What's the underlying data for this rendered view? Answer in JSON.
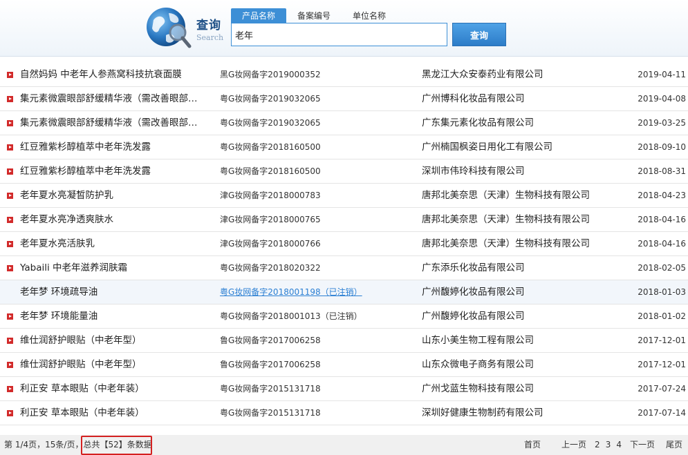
{
  "logo": {
    "cn": "查询",
    "en": "Search"
  },
  "search": {
    "tabs": [
      {
        "label": "产品名称",
        "active": true
      },
      {
        "label": "备案编号",
        "active": false
      },
      {
        "label": "单位名称",
        "active": false
      }
    ],
    "value": "老年",
    "button_label": "查询"
  },
  "results": [
    {
      "name": "自然妈妈 中老年人参燕窝科技抗衰面膜",
      "reg": "黑G妆网备字2019000352",
      "company": "黑龙江大众安泰药业有限公司",
      "date": "2019-04-11"
    },
    {
      "name": "集元素微震眼部舒缓精华液（需改善眼部…",
      "reg": "粤G妆网备字2019032065",
      "company": "广州博科化妆品有限公司",
      "date": "2019-04-08"
    },
    {
      "name": "集元素微震眼部舒缓精华液（需改善眼部…",
      "reg": "粤G妆网备字2019032065",
      "company": "广东集元素化妆品有限公司",
      "date": "2019-03-25"
    },
    {
      "name": "红豆雅紫杉醇植萃中老年洗发露",
      "reg": "粤G妆网备字2018160500",
      "company": "广州楠国枫姿日用化工有限公司",
      "date": "2018-09-10"
    },
    {
      "name": "红豆雅紫杉醇植萃中老年洗发露",
      "reg": "粤G妆网备字2018160500",
      "company": "深圳市伟玲科技有限公司",
      "date": "2018-08-31"
    },
    {
      "name": "老年夏水亮凝皙防护乳",
      "reg": "津G妆网备字2018000783",
      "company": "唐邦北美奈思（天津）生物科技有限公司",
      "date": "2018-04-23"
    },
    {
      "name": "老年夏水亮净透爽肤水",
      "reg": "津G妆网备字2018000765",
      "company": "唐邦北美奈思（天津）生物科技有限公司",
      "date": "2018-04-16"
    },
    {
      "name": "老年夏水亮活肤乳",
      "reg": "津G妆网备字2018000766",
      "company": "唐邦北美奈思（天津）生物科技有限公司",
      "date": "2018-04-16"
    },
    {
      "name": "Yabaili 中老年滋养润肤霜",
      "reg": "粤G妆网备字2018020322",
      "company": "广东添乐化妆品有限公司",
      "date": "2018-02-05"
    },
    {
      "name": "老年梦 环境疏导油",
      "reg": "粤G妆网备字2018001198（已注销）",
      "company": "广州馥婷化妆品有限公司",
      "date": "2018-01-03",
      "highlight": true
    },
    {
      "name": "老年梦 环境能量油",
      "reg": "粤G妆网备字2018001013（已注销）",
      "company": "广州馥婷化妆品有限公司",
      "date": "2018-01-02"
    },
    {
      "name": "维仕润舒护眼贴（中老年型）",
      "reg": "鲁G妆网备字2017006258",
      "company": "山东小美生物工程有限公司",
      "date": "2017-12-01"
    },
    {
      "name": "维仕润舒护眼贴（中老年型）",
      "reg": "鲁G妆网备字2017006258",
      "company": "山东众微电子商务有限公司",
      "date": "2017-12-01"
    },
    {
      "name": "利正安 草本眼贴（中老年装）",
      "reg": "粤G妆网备字2015131718",
      "company": "广州戈蓝生物科技有限公司",
      "date": "2017-07-24"
    },
    {
      "name": "利正安 草本眼贴（中老年装）",
      "reg": "粤G妆网备字2015131718",
      "company": "深圳好健康生物制药有限公司",
      "date": "2017-07-14"
    }
  ],
  "footer": {
    "info": "第 1/4页，15条/页，总共【52】条数据",
    "first": "首页",
    "prev": "上一页",
    "pages": [
      "2",
      "3",
      "4"
    ],
    "next": "下一页",
    "last": "尾页"
  },
  "colors": {
    "accent": "#3d8fd6",
    "bullet": "#d22a2a",
    "annotation": "#d42020",
    "link": "#2b7fd3"
  }
}
